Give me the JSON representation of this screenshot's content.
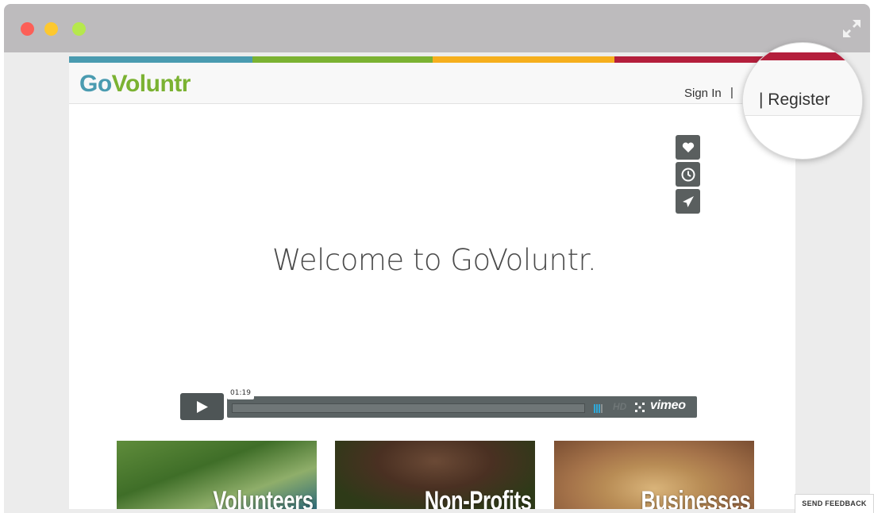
{
  "browser": {
    "controls": [
      "close",
      "minimize",
      "maximize"
    ],
    "expand_icon": "expand-arrows-icon"
  },
  "site": {
    "logo_part1": "Go",
    "logo_part2": "Voluntr",
    "brand_colors": [
      "#4a9bb0",
      "#7bb232",
      "#f6af1d",
      "#b41f3c"
    ],
    "nav": {
      "sign_in": "Sign In",
      "separator": "|",
      "register": "Register"
    }
  },
  "video": {
    "title": "Welcome to GoVoluntr.",
    "side_icons": [
      "heart-icon",
      "clock-icon",
      "send-icon"
    ],
    "time": "01:19",
    "hd_label": "HD",
    "provider_label": "vimeo",
    "play_icon": "play-icon"
  },
  "cards": [
    {
      "label": "Volunteers"
    },
    {
      "label": "Non-Profits"
    },
    {
      "label": "Businesses"
    }
  ],
  "zoom": {
    "text": "|  Register"
  },
  "feedback_label": "SEND FEEDBACK"
}
